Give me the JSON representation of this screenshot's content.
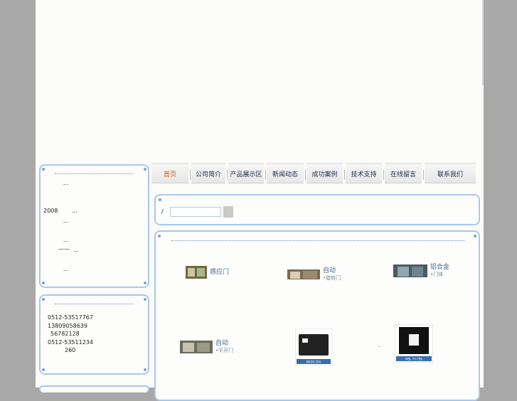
{
  "nav": {
    "items": [
      {
        "label": "首页",
        "active": true
      },
      {
        "label": "公司简介"
      },
      {
        "label": "产品展示区"
      },
      {
        "label": "新闻动态"
      },
      {
        "label": "成功案例"
      },
      {
        "label": "技术支持"
      },
      {
        "label": "在线留言"
      },
      {
        "label": "联系我们"
      }
    ]
  },
  "news": {
    "items": [
      {
        "prefix": "",
        "text": "..."
      },
      {
        "prefix": "2008",
        "text": "..."
      },
      {
        "prefix": "",
        "text": "..."
      },
      {
        "prefix": "",
        "text": "..."
      },
      {
        "prefix": "——",
        "text": "..."
      },
      {
        "prefix": "",
        "text": "..."
      }
    ]
  },
  "contact": {
    "lines": [
      "0512-53517767",
      "13809058639",
      "56782128",
      "0512-53511234",
      "260"
    ]
  },
  "search": {
    "label": "/",
    "placeholder": ""
  },
  "products": {
    "items": [
      {
        "title": "感应门",
        "subtitle": "",
        "icon": "sliding-door-photo"
      },
      {
        "title": "自动",
        "subtitle": "•旋转门",
        "icon": "revolving-door-photo"
      },
      {
        "title": "铝合金",
        "subtitle": "•门体",
        "icon": "aluminum-door-photo"
      },
      {
        "title": "自动",
        "subtitle": "•平开门",
        "icon": "swing-door-photo"
      },
      {
        "title": "",
        "subtitle": "",
        "label": "NAOS-16V",
        "icon": "controller-box-photo"
      },
      {
        "title": "",
        "subtitle": "",
        "label": "MSL 70:798",
        "icon": "sensor-panel-photo",
        "note": "."
      }
    ]
  },
  "colors": {
    "accent": "#d05a10",
    "box_border": "#a9c8ec",
    "text_link": "#3f6e94"
  }
}
